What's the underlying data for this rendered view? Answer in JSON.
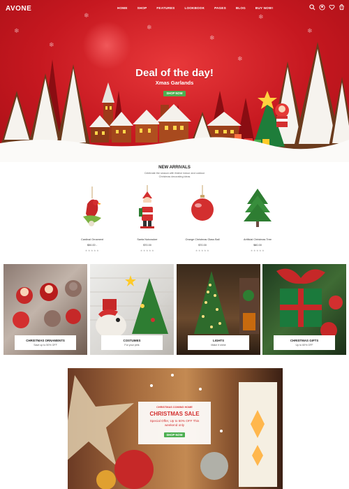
{
  "header": {
    "brand": "AVONE",
    "nav": [
      "HOME",
      "SHOP",
      "FEATURES",
      "LOOKBOOK",
      "PAGES",
      "BLOG",
      "BUY NOW!"
    ],
    "icons": [
      "search-icon",
      "user-icon",
      "heart-icon",
      "cart-icon"
    ],
    "cart_count": "0"
  },
  "hero": {
    "title": "Deal of the day!",
    "subtitle": "Xmas Garlands",
    "button": "SHOP NOW"
  },
  "new_arrivals": {
    "title": "NEW ARRIVALS",
    "subtitle": "Celebrate the season with festive indoor and outdoor Christmas decorating ideas",
    "products": [
      {
        "name": "Cardinal Ornament",
        "price": "$50.00 -",
        "stars": "★★★★★"
      },
      {
        "name": "Santa Nutcracker",
        "price": "$70.00",
        "stars": "★★★★★"
      },
      {
        "name": "Orange Christmas Glass Ball",
        "price": "$70.00",
        "stars": "★★★★★"
      },
      {
        "name": "Artificial Christmas Tree",
        "price": "$80.00",
        "stars": "★★★★★"
      }
    ]
  },
  "categories": [
    {
      "title": "CHRISTMAS ORNAMENTS",
      "sub": "Save up to 50% OFF"
    },
    {
      "title": "COSTUMES",
      "sub": "For your pets"
    },
    {
      "title": "LIGHTS",
      "sub": "Make it shine"
    },
    {
      "title": "CHRISTMAS GIFTS",
      "sub": "Up to 60% OFF"
    }
  ],
  "sale": {
    "kicker": "CHRISTMAS COMING HOME",
    "title": "CHRISTMAS SALE",
    "desc": "Special Offer, Up to 50% OFF This weekend only",
    "button": "SHOP NOW"
  },
  "colors": {
    "hero_red": "#c61820",
    "button_green": "#4caf50",
    "sale_red": "#d32f2f"
  }
}
